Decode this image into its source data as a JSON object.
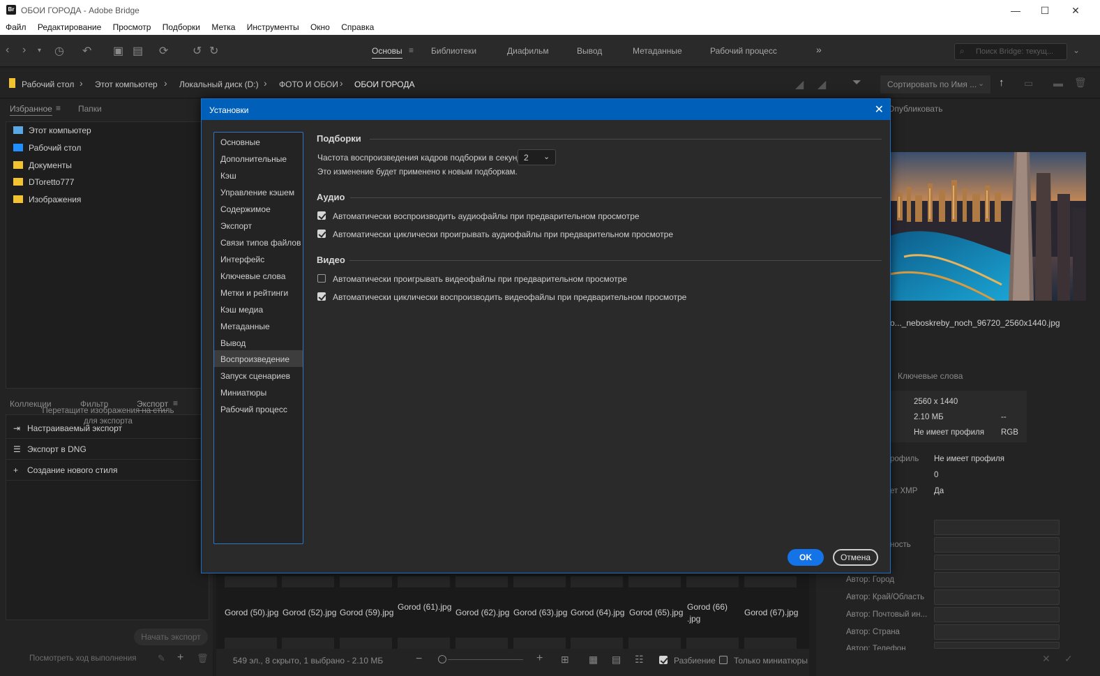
{
  "window": {
    "app_icon": "Br",
    "title": "ОБОИ ГОРОДА - Adobe Bridge",
    "controls": [
      "—",
      "☐",
      "✕"
    ]
  },
  "menu": [
    "Файл",
    "Редактирование",
    "Просмотр",
    "Подборки",
    "Метка",
    "Инструменты",
    "Окно",
    "Справка"
  ],
  "workspaces": [
    "Основы",
    "Библиотеки",
    "Диафильм",
    "Вывод",
    "Метаданные",
    "Рабочий процесс"
  ],
  "workspace_more": "»",
  "search": {
    "placeholder": "Поиск Bridge: текущ..."
  },
  "breadcrumb": [
    "Рабочий стол",
    "Этот компьютер",
    "Локальный диск (D:)",
    "ФОТО И ОБОИ",
    "ОБОИ ГОРОДА"
  ],
  "sort": {
    "label": "Сортировать по Имя ..."
  },
  "left_panel": {
    "tabs": [
      "Избранное",
      "Папки"
    ],
    "favorites": [
      {
        "label": "Этот компьютер",
        "icon": "computer-icon"
      },
      {
        "label": "Рабочий стол",
        "icon": "desktop-icon"
      },
      {
        "label": "Документы",
        "icon": "folder-icon"
      },
      {
        "label": "DToretto777",
        "icon": "folder-icon"
      },
      {
        "label": "Изображения",
        "icon": "folder-icon"
      }
    ],
    "bottom_tabs": [
      "Коллекции",
      "Фильтр",
      "Экспорт"
    ],
    "export_items": [
      {
        "label": "Настраиваемый экспорт",
        "icon": "export-icon"
      },
      {
        "label": "Экспорт в DNG",
        "icon": "list-icon"
      },
      {
        "label": "Создание нового стиля",
        "icon": "plus-icon"
      }
    ],
    "drop_hint": "Перетащите изображения на стиль для экспорта",
    "start_export": "Начать экспорт",
    "view_progress": "Посмотреть ход выполнения"
  },
  "content": {
    "thumbnails": [
      "Gorod (50).jpg",
      "Gorod (52).jpg",
      "Gorod (59).jpg",
      "Gorod (61).jpg",
      "Gorod (62).jpg",
      "Gorod (63).jpg",
      "Gorod (64).jpg",
      "Gorod (65).jpg",
      "Gorod (66) .jpg",
      "Gorod (67).jpg"
    ],
    "status": "549 эл., 8 скрыто, 1 выбрано - 2.10 МБ",
    "split_label": "Разбиение",
    "thumbs_only_label": "Только миниатюры"
  },
  "right_panel": {
    "publish_tab": "Опубликовать",
    "preview_filename": "о..._neboskreby_noch_96720_2560x1440.jpg",
    "keywords_tab": "Ключевые слова",
    "meta_summary": {
      "dimensions": "2560 x 1440",
      "size": "2.10 МБ",
      "dash": "--",
      "profile": "Не имеет профиля",
      "mode": "RGB"
    },
    "meta_rows": [
      {
        "label": "рофиль",
        "value": "Не имеет профиля"
      },
      {
        "label": "",
        "value": "0"
      },
      {
        "label": "ет XMP",
        "value": "Да"
      }
    ],
    "author_fields": [
      "ность",
      "",
      "Автор: Город",
      "Автор: Край/Область",
      "Автор: Почтовый ин...",
      "Автор: Страна",
      "Автор: Телефон"
    ]
  },
  "dialog": {
    "title": "Установки",
    "categories": [
      "Основные",
      "Дополнительные",
      "Кэш",
      "Управление кэшем",
      "Содержимое",
      "Экспорт",
      "Связи типов файлов",
      "Интерфейс",
      "Ключевые слова",
      "Метки и рейтинги",
      "Кэш медиа",
      "Метаданные",
      "Вывод",
      "Воспроизведение",
      "Запуск сценариев",
      "Миниатюры",
      "Рабочий процесс"
    ],
    "selected_category": "Воспроизведение",
    "sections": {
      "collections": {
        "header": "Подборки",
        "fps_label": "Частота воспроизведения кадров подборки в секунду",
        "fps_value": "2",
        "note": "Это изменение будет применено к новым подборкам."
      },
      "audio": {
        "header": "Аудио",
        "options": [
          {
            "label": "Автоматически воспроизводить аудиофайлы при предварительном просмотре",
            "checked": true
          },
          {
            "label": "Автоматически циклически проигрывать аудиофайлы при предварительном просмотре",
            "checked": true
          }
        ]
      },
      "video": {
        "header": "Видео",
        "options": [
          {
            "label": "Автоматически проигрывать видеофайлы при предварительном просмотре",
            "checked": false
          },
          {
            "label": "Автоматически циклически воспроизводить видеофайлы при предварительном просмотре",
            "checked": true
          }
        ]
      }
    },
    "ok_label": "OK",
    "cancel_label": "Отмена"
  },
  "colors": {
    "accent": "#1473e6",
    "dialog_title_bg": "#005fb8",
    "panel_bg": "#232323"
  }
}
